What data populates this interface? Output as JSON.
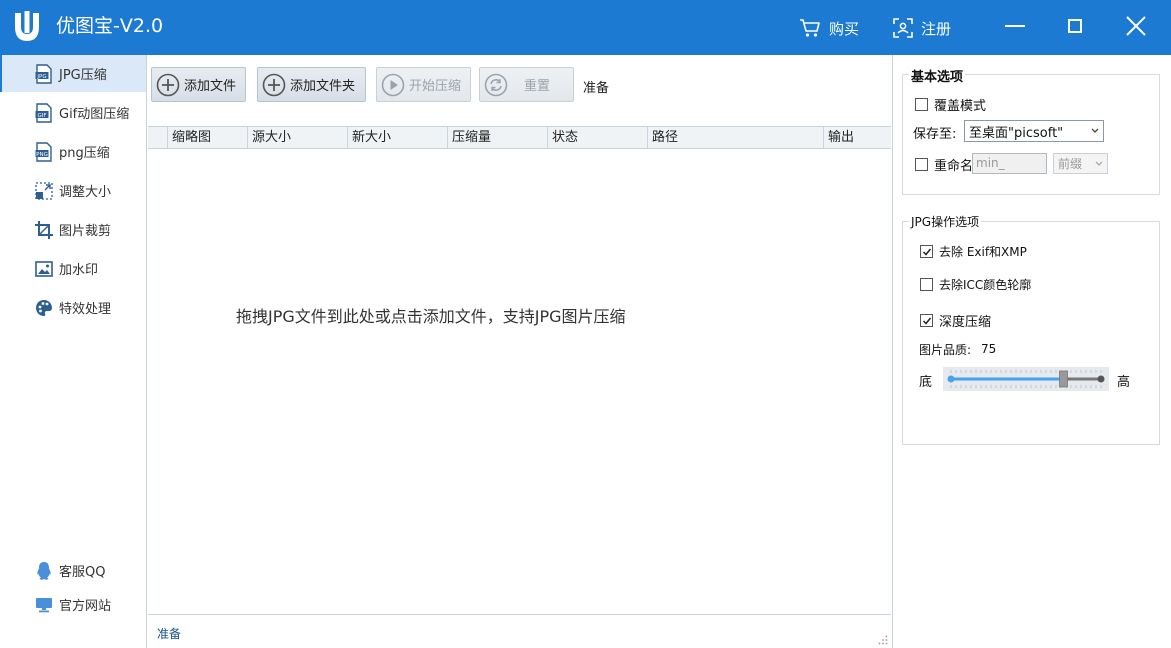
{
  "app": {
    "title": "优图宝-V2.0",
    "buy_label": "购买",
    "register_label": "注册",
    "accent_color": "#1c7ad3"
  },
  "sidebar": {
    "items": [
      {
        "label": "JPG压缩",
        "icon": "jpg-file-icon",
        "active": true
      },
      {
        "label": "Gif动图压缩",
        "icon": "gif-file-icon",
        "active": false
      },
      {
        "label": "png压缩",
        "icon": "png-file-icon",
        "active": false
      },
      {
        "label": "调整大小",
        "icon": "resize-icon",
        "active": false
      },
      {
        "label": "图片裁剪",
        "icon": "crop-icon",
        "active": false
      },
      {
        "label": "加水印",
        "icon": "watermark-image-icon",
        "active": false
      },
      {
        "label": "特效处理",
        "icon": "palette-icon",
        "active": false
      }
    ],
    "footer": [
      {
        "label": "客服QQ",
        "icon": "qq-penguin-icon"
      },
      {
        "label": "官方网站",
        "icon": "monitor-icon"
      }
    ]
  },
  "toolbar": {
    "add_file_label": "添加文件",
    "add_folder_label": "添加文件夹",
    "start_label": "开始压缩",
    "reset_label": "重置",
    "status": "准备"
  },
  "table": {
    "columns": [
      "缩略图",
      "源大小",
      "新大小",
      "压缩量",
      "状态",
      "路径",
      "输出"
    ],
    "rows": [],
    "empty_hint": "拖拽JPG文件到此处或点击添加文件，支持JPG图片压缩"
  },
  "statusbar": {
    "text": "准备"
  },
  "basic_options": {
    "title": "基本选项",
    "overwrite_label": "覆盖模式",
    "overwrite_checked": false,
    "save_to_label": "保存至:",
    "save_to_value": "至桌面\"picsoft\"",
    "rename_label": "重命名",
    "rename_checked": false,
    "rename_placeholder": "min_",
    "prefix_value": "前缀"
  },
  "jpg_options": {
    "title": "JPG操作选项",
    "remove_exif_label": "去除 Exif和XMP",
    "remove_exif_checked": true,
    "remove_icc_label": "去除ICC颜色轮廓",
    "remove_icc_checked": false,
    "deep_compress_label": "深度压缩",
    "deep_compress_checked": true,
    "quality_label": "图片品质:",
    "quality_value": "75",
    "quality_fraction": 0.75,
    "low_label": "底",
    "high_label": "高"
  }
}
